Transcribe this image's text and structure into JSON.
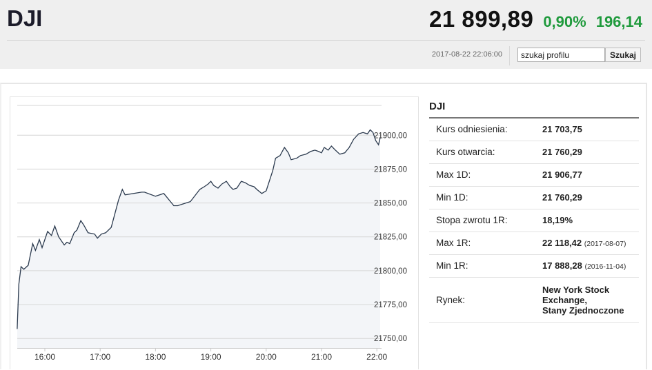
{
  "header": {
    "ticker": "DJI",
    "price": "21 899,89",
    "change_pct": "0,90%",
    "change_abs": "196,14",
    "timestamp": "2017-08-22 22:06:00"
  },
  "search": {
    "value": "szukaj profilu",
    "button_label": "Szukaj"
  },
  "info": {
    "title": "DJI",
    "rows": [
      {
        "label": "Kurs odniesienia:",
        "value": "21 703,75",
        "note": ""
      },
      {
        "label": "Kurs otwarcia:",
        "value": "21 760,29",
        "note": ""
      },
      {
        "label": "Max 1D:",
        "value": "21 906,77",
        "note": ""
      },
      {
        "label": "Min 1D:",
        "value": "21 760,29",
        "note": ""
      },
      {
        "label": "Stopa zwrotu 1R:",
        "value": "18,19%",
        "note": ""
      },
      {
        "label": "Max 1R:",
        "value": "22 118,42",
        "note": "(2017-08-07)"
      },
      {
        "label": "Min 1R:",
        "value": "17 888,28",
        "note": "(2016-11-04)"
      },
      {
        "label": "Rynek:",
        "value_lines": [
          "New York Stock",
          "Exchange,",
          "Stany Zjednoczone"
        ]
      }
    ]
  },
  "colors": {
    "positive": "#1f9a3c",
    "line": "#2b3a4e",
    "area": "#f3f5f8"
  },
  "chart_data": {
    "type": "area",
    "x_ticks": [
      "16:00",
      "17:00",
      "18:00",
      "19:00",
      "20:00",
      "21:00",
      "22:00"
    ],
    "y_ticks": [
      "21 750,00",
      "21 775,00",
      "21 800,00",
      "21 825,00",
      "21 850,00",
      "21 875,00",
      "21 900,00"
    ],
    "y_tick_labels": [
      "21750,00",
      "21775,00",
      "21800,00",
      "21825,00",
      "21850,00",
      "21875,00",
      "21900,00"
    ],
    "ylim": [
      21743,
      21922
    ],
    "xlim_hours": [
      15.5,
      22.12
    ],
    "grid": true,
    "points": [
      [
        15.5,
        21757
      ],
      [
        15.53,
        21790
      ],
      [
        15.57,
        21803
      ],
      [
        15.62,
        21801
      ],
      [
        15.7,
        21804
      ],
      [
        15.78,
        21820
      ],
      [
        15.83,
        21815
      ],
      [
        15.9,
        21823
      ],
      [
        15.95,
        21817
      ],
      [
        16.05,
        21829
      ],
      [
        16.12,
        21826
      ],
      [
        16.18,
        21833
      ],
      [
        16.25,
        21825
      ],
      [
        16.35,
        21819
      ],
      [
        16.4,
        21821
      ],
      [
        16.45,
        21820
      ],
      [
        16.53,
        21828
      ],
      [
        16.58,
        21830
      ],
      [
        16.65,
        21837
      ],
      [
        16.7,
        21834
      ],
      [
        16.78,
        21828
      ],
      [
        16.9,
        21827
      ],
      [
        16.95,
        21824
      ],
      [
        17.02,
        21827
      ],
      [
        17.1,
        21828
      ],
      [
        17.2,
        21832
      ],
      [
        17.33,
        21852
      ],
      [
        17.4,
        21860
      ],
      [
        17.45,
        21856
      ],
      [
        17.75,
        21858
      ],
      [
        17.8,
        21858
      ],
      [
        18.0,
        21855
      ],
      [
        18.15,
        21857
      ],
      [
        18.33,
        21848
      ],
      [
        18.4,
        21848
      ],
      [
        18.55,
        21850
      ],
      [
        18.63,
        21851
      ],
      [
        18.8,
        21860
      ],
      [
        18.88,
        21862
      ],
      [
        18.95,
        21864
      ],
      [
        19.0,
        21866
      ],
      [
        19.05,
        21863
      ],
      [
        19.13,
        21861
      ],
      [
        19.2,
        21864
      ],
      [
        19.28,
        21866
      ],
      [
        19.35,
        21862
      ],
      [
        19.4,
        21860
      ],
      [
        19.47,
        21861
      ],
      [
        19.55,
        21866
      ],
      [
        19.62,
        21865
      ],
      [
        19.7,
        21863
      ],
      [
        19.78,
        21862
      ],
      [
        19.83,
        21860
      ],
      [
        19.92,
        21857
      ],
      [
        20.0,
        21859
      ],
      [
        20.12,
        21874
      ],
      [
        20.17,
        21883
      ],
      [
        20.25,
        21885
      ],
      [
        20.33,
        21891
      ],
      [
        20.4,
        21887
      ],
      [
        20.45,
        21882
      ],
      [
        20.55,
        21883
      ],
      [
        20.62,
        21885
      ],
      [
        20.72,
        21886
      ],
      [
        20.8,
        21888
      ],
      [
        20.88,
        21889
      ],
      [
        20.95,
        21888
      ],
      [
        21.0,
        21887
      ],
      [
        21.05,
        21891
      ],
      [
        21.12,
        21889
      ],
      [
        21.18,
        21892
      ],
      [
        21.25,
        21889
      ],
      [
        21.33,
        21886
      ],
      [
        21.42,
        21887
      ],
      [
        21.5,
        21891
      ],
      [
        21.58,
        21897
      ],
      [
        21.67,
        21901
      ],
      [
        21.75,
        21902
      ],
      [
        21.83,
        21901
      ],
      [
        21.88,
        21904
      ],
      [
        21.93,
        21902
      ],
      [
        21.98,
        21896
      ],
      [
        22.03,
        21893
      ],
      [
        22.06,
        21898
      ]
    ]
  }
}
